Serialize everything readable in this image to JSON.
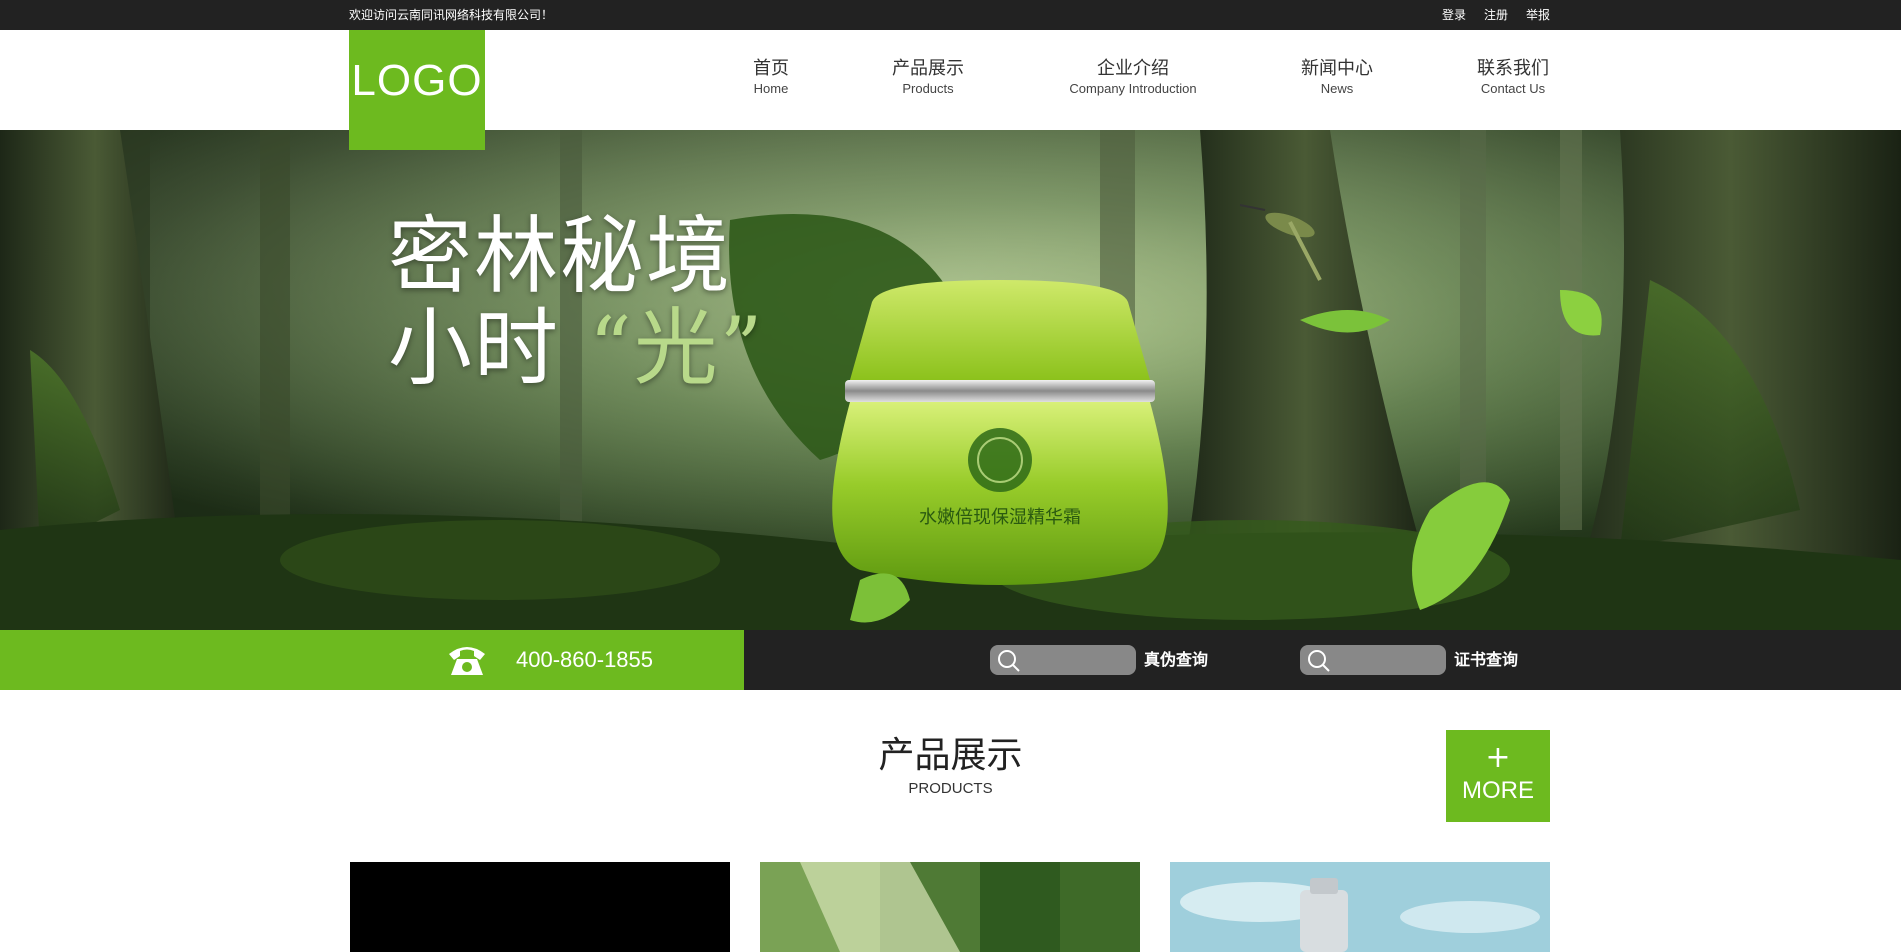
{
  "topbar": {
    "welcome": "欢迎访问云南同讯网络科技有限公司！",
    "links": [
      "登录",
      "注册",
      "举报"
    ]
  },
  "logo": {
    "text": "LOGO"
  },
  "nav": {
    "items": [
      {
        "cn": "首页",
        "en": "Home"
      },
      {
        "cn": "产品展示",
        "en": "Products"
      },
      {
        "cn": "企业介绍",
        "en": "Company Introduction"
      },
      {
        "cn": "新闻中心",
        "en": "News"
      },
      {
        "cn": "联系我们",
        "en": "Contact Us"
      }
    ]
  },
  "banner": {
    "line1": "密林秘境",
    "line2_a": "小时",
    "line2_b": "“光”",
    "jar_text": "水嫩倍现保湿精华霜"
  },
  "strip": {
    "phone": "400-860-1855",
    "search1": {
      "placeholder": "",
      "label": "真伪查询"
    },
    "search2": {
      "placeholder": "",
      "label": "证书查询"
    }
  },
  "products_section": {
    "title": "产品展示",
    "subtitle": "PRODUCTS",
    "more_plus": "+",
    "more_label": "MORE"
  },
  "colors": {
    "accent": "#6dba1f",
    "dark": "#222222"
  },
  "icons": {
    "phone": "telephone-icon",
    "search": "search-icon"
  }
}
